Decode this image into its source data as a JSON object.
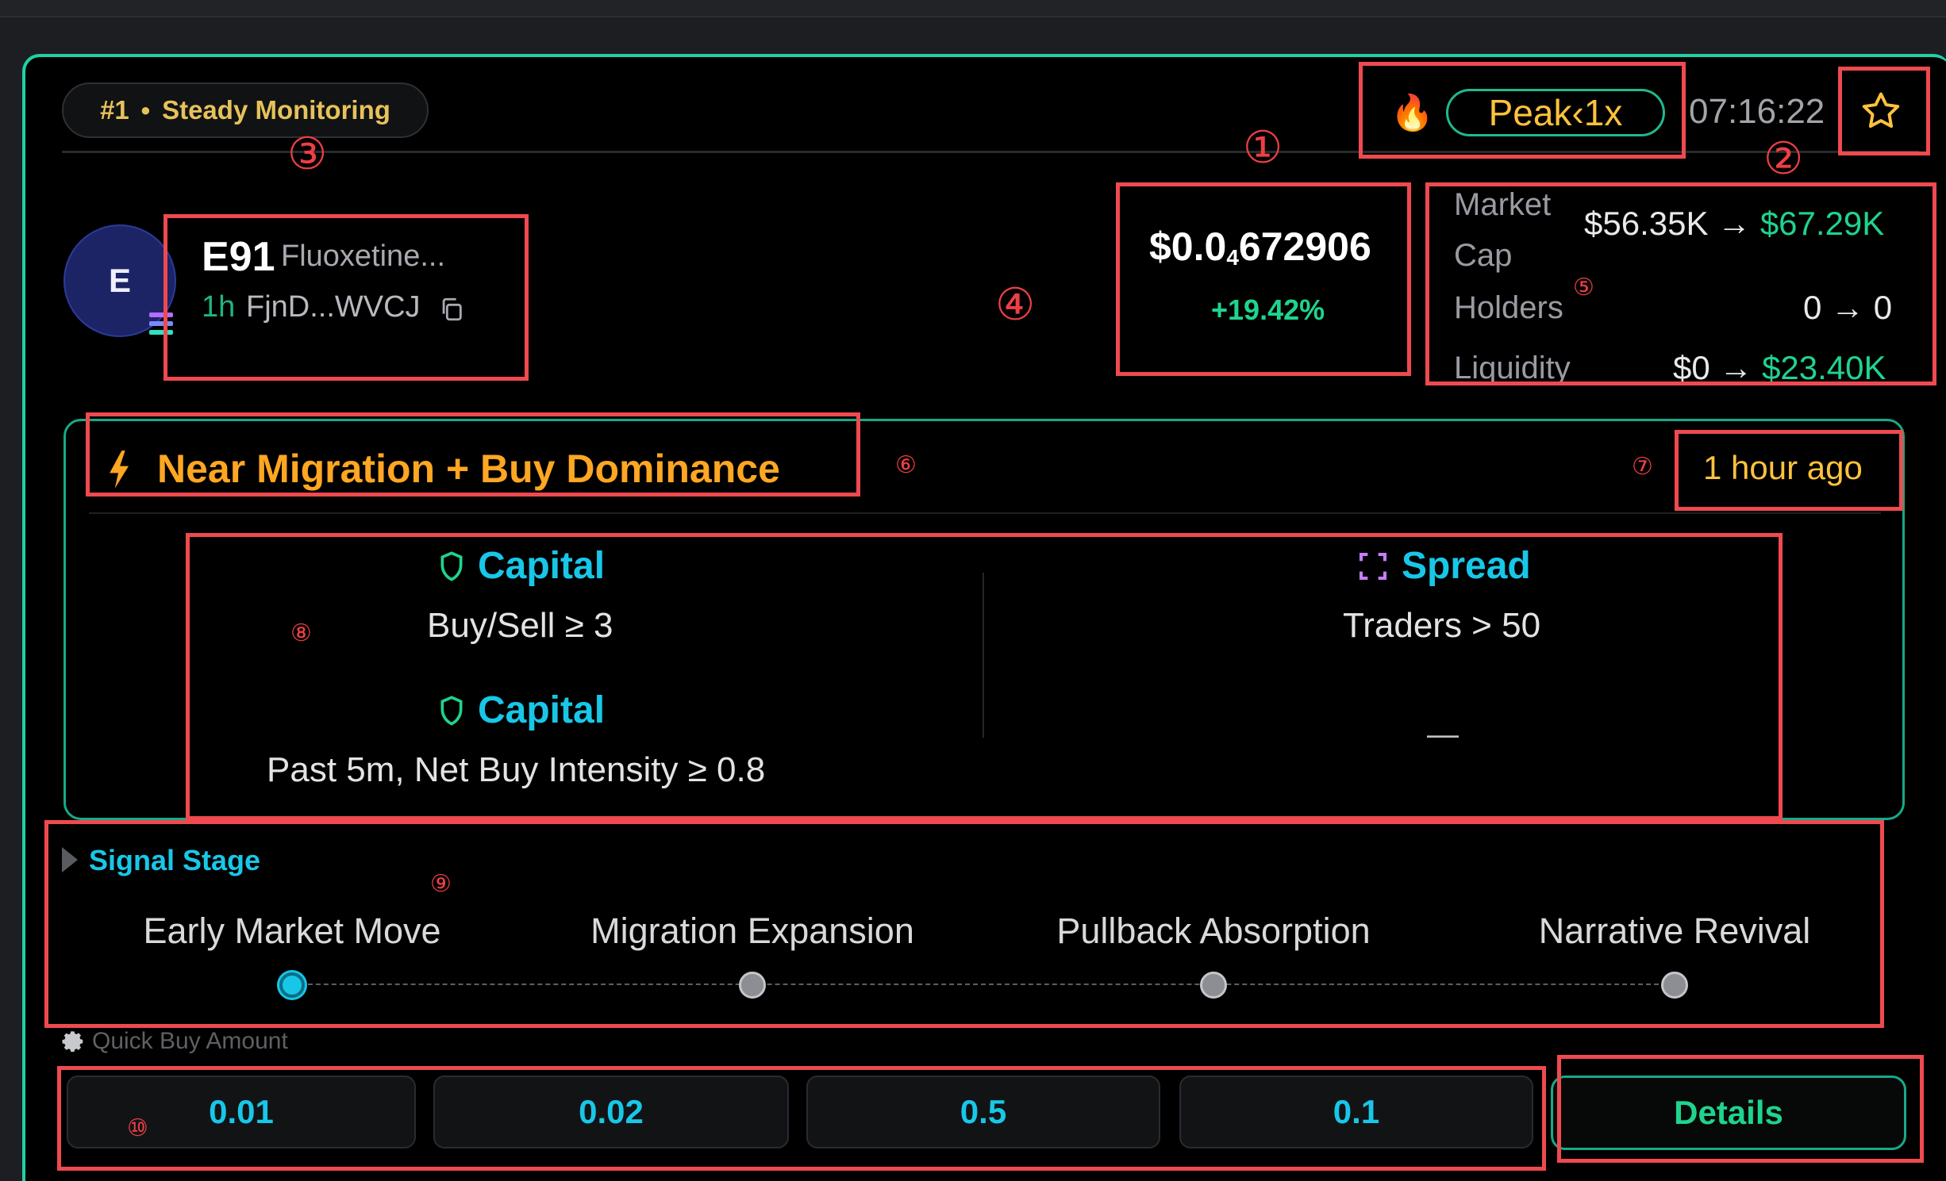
{
  "badge": {
    "rank": "#1",
    "dot": "●",
    "status": "Steady Monitoring"
  },
  "header": {
    "fire_icon": "🔥",
    "peak_label": "Peak‹1x",
    "time": "07:16:22",
    "star_icon": "star-icon"
  },
  "annotations": {
    "n1": "①",
    "n2": "②",
    "n3": "③",
    "n4": "④",
    "n5": "⑤",
    "n6": "⑥",
    "n7": "⑦",
    "n8": "⑧",
    "n9": "⑨",
    "n10": "⑩"
  },
  "token": {
    "avatar_letter": "E",
    "symbol": "E91",
    "name": "Fluoxetine...",
    "age": "1h",
    "address": "FjnD...WVCJ"
  },
  "price": {
    "prefix": "$0.0",
    "subscript": "4",
    "digits": "672906",
    "change": "+19.42%"
  },
  "stats": {
    "market_cap_label_1": "Market",
    "market_cap_label_2": "Cap",
    "market_cap_from": "$56.35K",
    "market_cap_to": "$67.29K",
    "holders_label": "Holders",
    "holders_from": "0",
    "holders_to": "0",
    "liquidity_label": "Liquidity",
    "liquidity_from": "$0",
    "liquidity_to": "$23.40K",
    "arrow": "→"
  },
  "signal": {
    "title": "Near Migration + Buy Dominance",
    "time_ago": "1 hour ago",
    "conditions": [
      {
        "category": "Capital",
        "rule": "Buy/Sell ≥ 3"
      },
      {
        "category": "Spread",
        "rule": "Traders > 50"
      },
      {
        "category": "Capital",
        "rule": "Past 5m, Net Buy Intensity ≥ 0.8"
      },
      {
        "category": "",
        "rule": "—"
      }
    ]
  },
  "stage": {
    "title": "Signal Stage",
    "steps": [
      "Early Market Move",
      "Migration Expansion",
      "Pullback Absorption",
      "Narrative Revival"
    ],
    "active_index": 0
  },
  "quick_buy": {
    "label": "Quick Buy Amount",
    "amounts": [
      "0.01",
      "0.02",
      "0.5",
      "0.1"
    ],
    "details_label": "Details"
  },
  "colors": {
    "accent": "#1fd1a5",
    "highlight": "#ee4a4f",
    "positive": "#1fd48e",
    "cyan": "#18c7e8",
    "gold": "#ffc23c"
  }
}
